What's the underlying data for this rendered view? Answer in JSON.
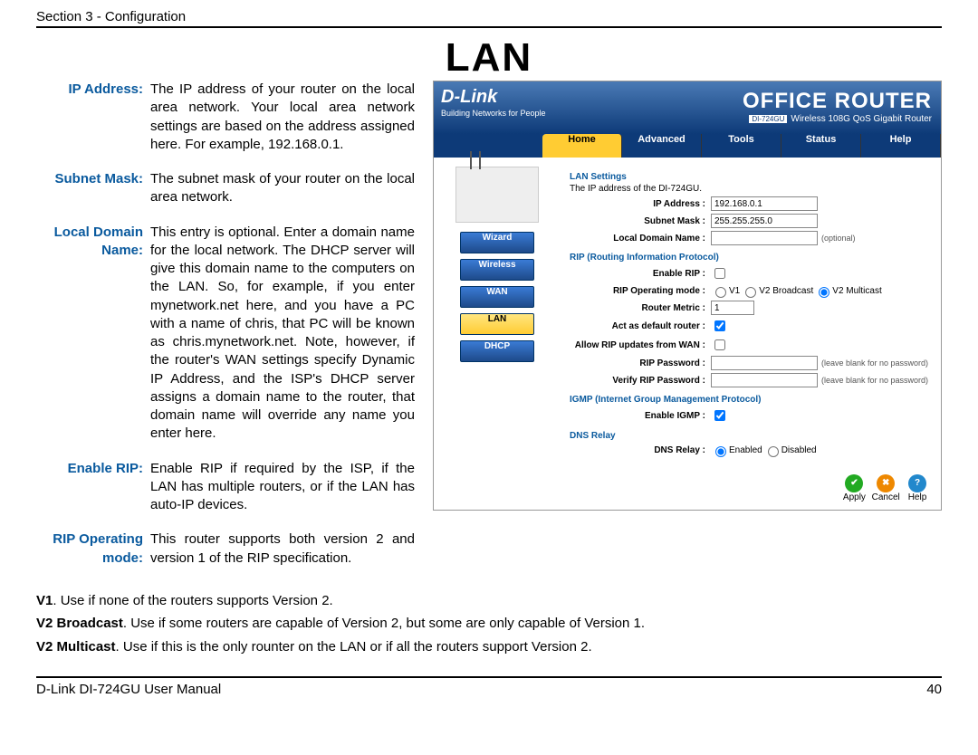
{
  "header": "Section 3 - Configuration",
  "title": "LAN",
  "defs": [
    {
      "t": "IP Address:",
      "d": "The IP address of your router on the local area network. Your local area network settings are based on the address assigned here. For example, 192.168.0.1."
    },
    {
      "t": "Subnet Mask:",
      "d": "The subnet mask of your router on the local area network."
    },
    {
      "t": "Local Domain Name:",
      "d": "This entry is optional. Enter a domain name for the local network. The DHCP server will give this domain name to the computers on the LAN. So, for example, if you enter mynetwork.net here, and you have a PC with a name of chris, that PC will be known as chris.mynetwork.net. Note, however, if the router's WAN settings specify Dynamic IP Address, and the ISP's DHCP server assigns a domain name to the router, that domain name will override any name you enter here."
    },
    {
      "t": "Enable RIP:",
      "d": "Enable RIP if required by the ISP, if the LAN has multiple routers, or if the LAN has auto-IP devices."
    },
    {
      "t": "RIP Operating mode:",
      "d": "This router supports both version 2 and version 1 of the RIP specification."
    }
  ],
  "extra": {
    "v1": "V1",
    "v1t": ". Use if none of the routers supports Version 2.",
    "v2b": "V2 Broadcast",
    "v2bt": ". Use if some routers are capable of Version 2, but some are only capable of Version 1.",
    "v2m": "V2 Multicast",
    "v2mt": ". Use if this is the only rounter on the LAN or if all the routers support Version 2."
  },
  "footer": {
    "l": "D-Link DI-724GU User Manual",
    "r": "40"
  },
  "ui": {
    "logo": "D-Link",
    "tag": "Building Networks for People",
    "prod": "OFFICE ROUTER",
    "model": "DI-724GU",
    "sub": "Wireless 108G QoS Gigabit Router",
    "tabs": [
      "Home",
      "Advanced",
      "Tools",
      "Status",
      "Help"
    ],
    "side": [
      "Wizard",
      "Wireless",
      "WAN",
      "LAN",
      "DHCP"
    ],
    "sec1": "LAN Settings",
    "sec1d": "The IP address of the DI-724GU.",
    "f": {
      "ip": "IP Address :",
      "ipv": "192.168.0.1",
      "sm": "Subnet Mask :",
      "smv": "255.255.255.0",
      "ld": "Local Domain Name :",
      "opt": "(optional)"
    },
    "sec2": "RIP (Routing Information Protocol)",
    "r": {
      "en": "Enable RIP :",
      "om": "RIP Operating mode :",
      "v1": "V1",
      "v2b": "V2 Broadcast",
      "v2m": "V2 Multicast",
      "rm": "Router Metric :",
      "rmv": "1",
      "def": "Act as default router :",
      "wan": "Allow RIP updates from WAN :",
      "pw": "RIP Password :",
      "vpw": "Verify RIP Password :",
      "pwn": "(leave blank for no password)"
    },
    "sec3": "IGMP (Internet Group Management Protocol)",
    "ig": "Enable IGMP :",
    "sec4": "DNS Relay",
    "dns": "DNS Relay :",
    "en": "Enabled",
    "dis": "Disabled",
    "btns": {
      "a": "Apply",
      "c": "Cancel",
      "h": "Help"
    }
  }
}
